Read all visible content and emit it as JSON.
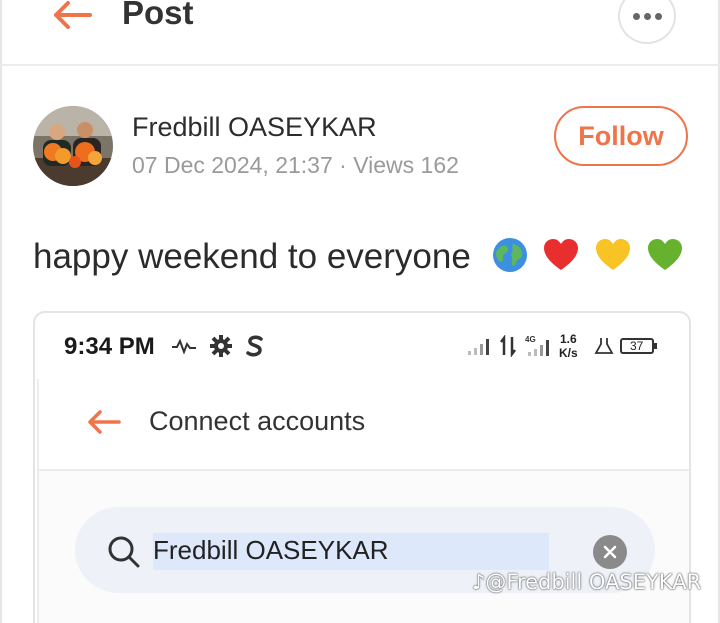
{
  "header": {
    "title": "Post",
    "back_icon": "arrow-left-icon",
    "more_icon": "more-dots-icon"
  },
  "post": {
    "author_name": "Fredbill OASEYKAR",
    "meta": "07 Dec 2024, 21:37 · Views 162",
    "follow_label": "Follow",
    "text": "happy weekend to everyone",
    "emojis": [
      "globe-emoji",
      "red-heart-emoji",
      "yellow-heart-emoji",
      "green-heart-emoji"
    ]
  },
  "embed": {
    "status_bar": {
      "time": "9:34 PM",
      "net_speed_value": "1.6",
      "net_speed_unit": "K/s",
      "network_type": "4G",
      "battery": "37"
    },
    "screen": {
      "title": "Connect accounts",
      "search_value": "Fredbill OASEYKAR"
    }
  },
  "watermark": "@Fredbill OASEYKAR",
  "colors": {
    "accent": "#f0744a",
    "meta_text": "#9a9a9a",
    "search_bg": "#eef2f8"
  }
}
